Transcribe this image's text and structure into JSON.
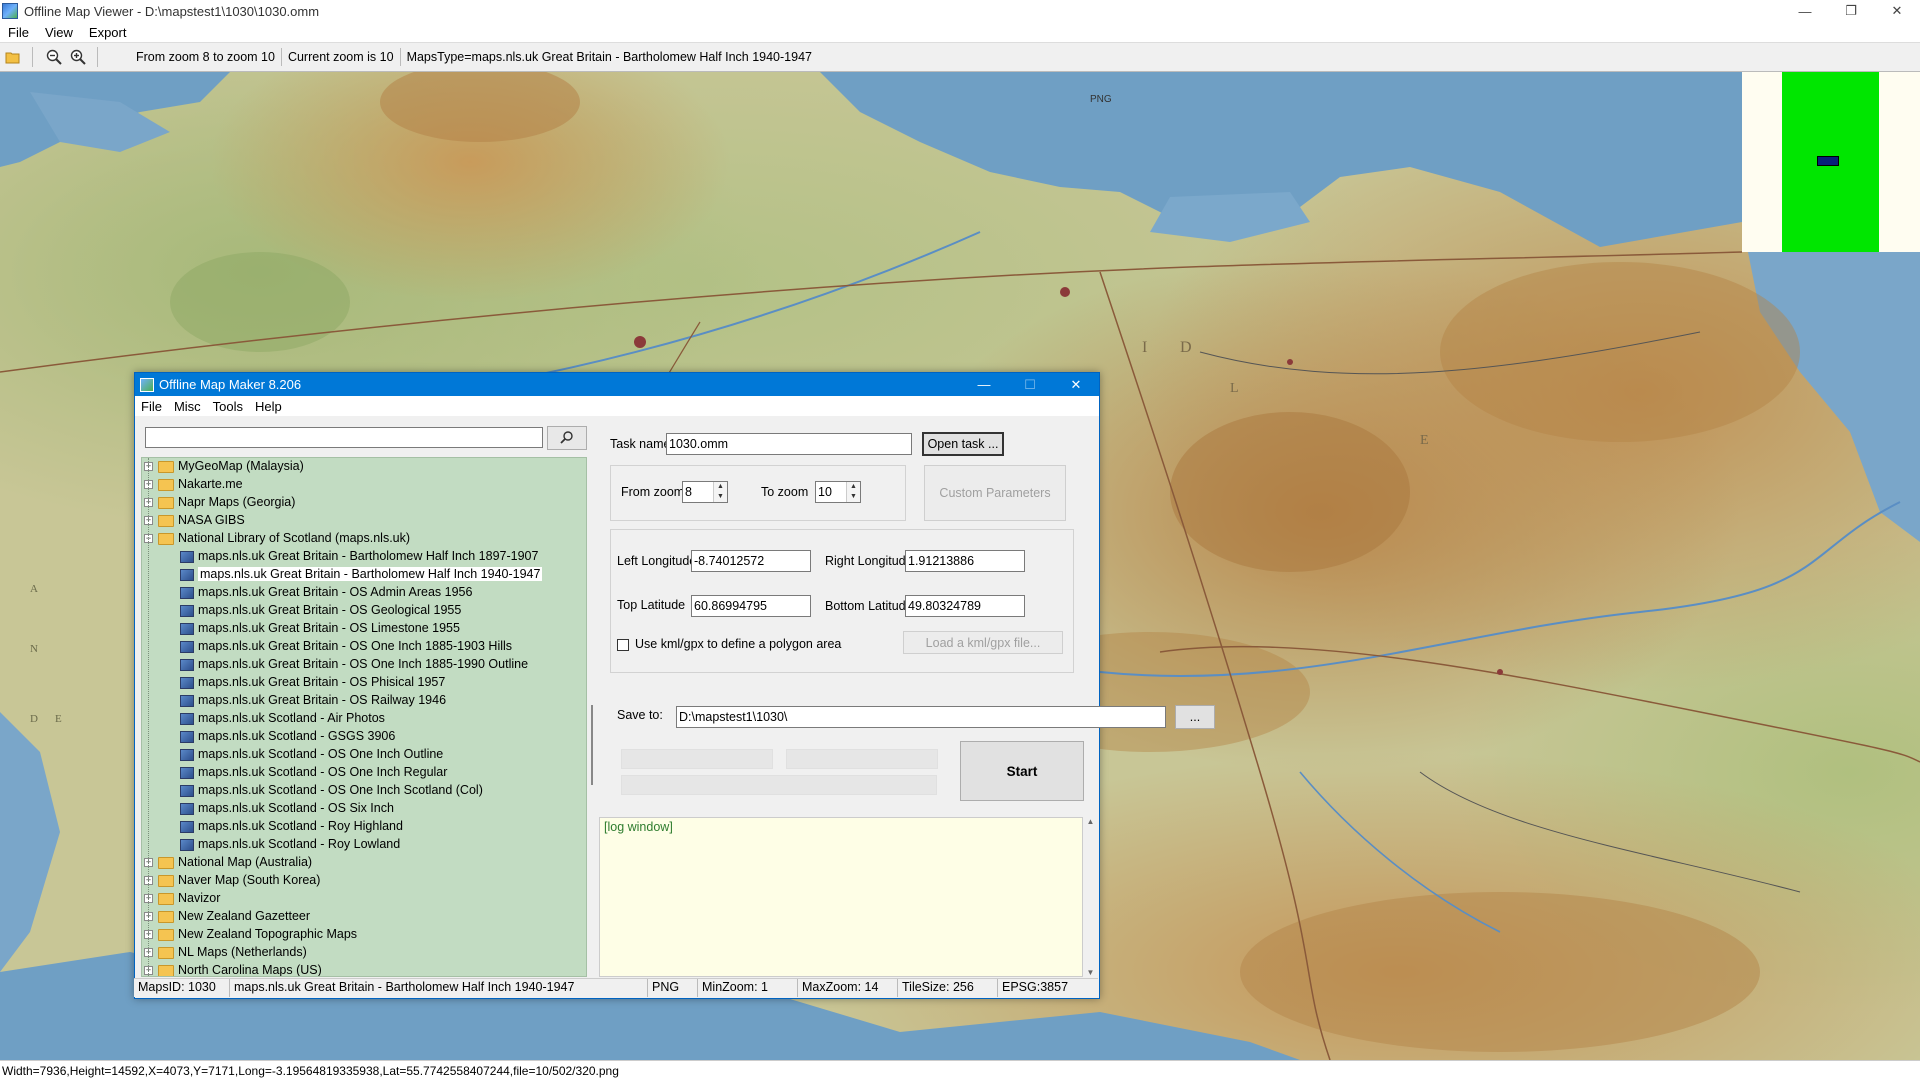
{
  "viewer": {
    "title": "Offline Map Viewer - D:\\mapstest1\\1030\\1030.omm",
    "menu": [
      "File",
      "View",
      "Export"
    ],
    "toolbar": {
      "zoom_range": "From zoom 8 to zoom 10",
      "current_zoom": "Current zoom is 10",
      "maps_type": "MapsType=maps.nls.uk Great Britain - Bartholomew Half Inch 1940-1947"
    },
    "status": "Width=7936,Height=14592,X=4073,Y=7171,Long=-3.19564819335938,Lat=55.7742558407244,file=10/502/320.png",
    "map_labels": [
      "PNG",
      "I",
      "D",
      "A",
      "N",
      "D",
      "E",
      "L",
      "E"
    ]
  },
  "maker": {
    "title": "Offline Map Maker 8.206",
    "menu": [
      "File",
      "Misc",
      "Tools",
      "Help"
    ],
    "search": {
      "value": "",
      "placeholder": ""
    },
    "tree": [
      {
        "label": "MyGeoMap (Malaysia)",
        "type": "folder",
        "level": 0,
        "expanded": false
      },
      {
        "label": "Nakarte.me",
        "type": "folder",
        "level": 0,
        "expanded": false
      },
      {
        "label": "Napr Maps (Georgia)",
        "type": "folder",
        "level": 0,
        "expanded": false
      },
      {
        "label": "NASA GIBS",
        "type": "folder",
        "level": 0,
        "expanded": false
      },
      {
        "label": "National Library of Scotland (maps.nls.uk)",
        "type": "folder",
        "level": 0,
        "expanded": true
      },
      {
        "label": "maps.nls.uk Great Britain - Bartholomew Half Inch 1897-1907",
        "type": "map",
        "level": 1
      },
      {
        "label": "maps.nls.uk Great Britain - Bartholomew Half Inch 1940-1947",
        "type": "map",
        "level": 1,
        "selected": true
      },
      {
        "label": "maps.nls.uk Great Britain - OS Admin Areas 1956",
        "type": "map",
        "level": 1
      },
      {
        "label": "maps.nls.uk Great Britain - OS Geological 1955",
        "type": "map",
        "level": 1
      },
      {
        "label": "maps.nls.uk Great Britain - OS Limestone 1955",
        "type": "map",
        "level": 1
      },
      {
        "label": "maps.nls.uk Great Britain - OS One Inch 1885-1903 Hills",
        "type": "map",
        "level": 1
      },
      {
        "label": "maps.nls.uk Great Britain - OS One Inch 1885-1990 Outline",
        "type": "map",
        "level": 1
      },
      {
        "label": "maps.nls.uk Great Britain - OS Phisical 1957",
        "type": "map",
        "level": 1
      },
      {
        "label": "maps.nls.uk Great Britain - OS Railway 1946",
        "type": "map",
        "level": 1
      },
      {
        "label": "maps.nls.uk Scotland - Air Photos",
        "type": "map",
        "level": 1
      },
      {
        "label": "maps.nls.uk Scotland - GSGS 3906",
        "type": "map",
        "level": 1
      },
      {
        "label": "maps.nls.uk Scotland - OS One Inch Outline",
        "type": "map",
        "level": 1
      },
      {
        "label": "maps.nls.uk Scotland - OS One Inch Regular",
        "type": "map",
        "level": 1
      },
      {
        "label": "maps.nls.uk Scotland - OS One Inch Scotland (Col)",
        "type": "map",
        "level": 1
      },
      {
        "label": "maps.nls.uk Scotland - OS Six Inch",
        "type": "map",
        "level": 1
      },
      {
        "label": "maps.nls.uk Scotland - Roy Highland",
        "type": "map",
        "level": 1
      },
      {
        "label": "maps.nls.uk Scotland - Roy Lowland",
        "type": "map",
        "level": 1
      },
      {
        "label": "National Map (Australia)",
        "type": "folder",
        "level": 0,
        "expanded": false
      },
      {
        "label": "Naver Map (South Korea)",
        "type": "folder",
        "level": 0,
        "expanded": false
      },
      {
        "label": "Navizor",
        "type": "folder",
        "level": 0,
        "expanded": false
      },
      {
        "label": "New Zealand Gazetteer",
        "type": "folder",
        "level": 0,
        "expanded": false
      },
      {
        "label": "New Zealand Topographic Maps",
        "type": "folder",
        "level": 0,
        "expanded": false
      },
      {
        "label": "NL Maps (Netherlands)",
        "type": "folder",
        "level": 0,
        "expanded": false
      },
      {
        "label": "North Carolina Maps (US)",
        "type": "folder",
        "level": 0,
        "expanded": false
      }
    ],
    "form": {
      "task_name_label": "Task name",
      "task_name_value": "1030.omm",
      "open_task_label": "Open task ...",
      "from_zoom_label": "From zoom",
      "from_zoom_value": "8",
      "to_zoom_label": "To zoom",
      "to_zoom_value": "10",
      "custom_params_label": "Custom Parameters",
      "left_lon_label": "Left Longitude",
      "left_lon_value": "-8.74012572",
      "right_lon_label": "Right Longitude",
      "right_lon_value": "1.91213886",
      "top_lat_label": "Top Latitude",
      "top_lat_value": "60.86994795",
      "bottom_lat_label": "Bottom Latitude",
      "bottom_lat_value": "49.80324789",
      "kml_checkbox_label": "Use kml/gpx to define a polygon area",
      "load_kml_label": "Load a kml/gpx file...",
      "save_to_label": "Save to:",
      "save_to_value": "D:\\mapstest1\\1030\\",
      "browse_label": "...",
      "start_label": "Start",
      "log_text": "[log window]"
    },
    "status": {
      "maps_id": "MapsID: 1030",
      "maps_name": "maps.nls.uk Great Britain - Bartholomew Half Inch 1940-1947",
      "format": "PNG",
      "min_zoom": "MinZoom: 1",
      "max_zoom": "MaxZoom: 14",
      "tile_size": "TileSize: 256",
      "epsg": "EPSG:3857"
    }
  },
  "colors": {
    "titlebar_active": "#0078d7",
    "tree_bg": "#c2dcc2",
    "log_bg": "#fefee6",
    "minimap_green": "#00e600",
    "sea": "#6f9fc4"
  }
}
